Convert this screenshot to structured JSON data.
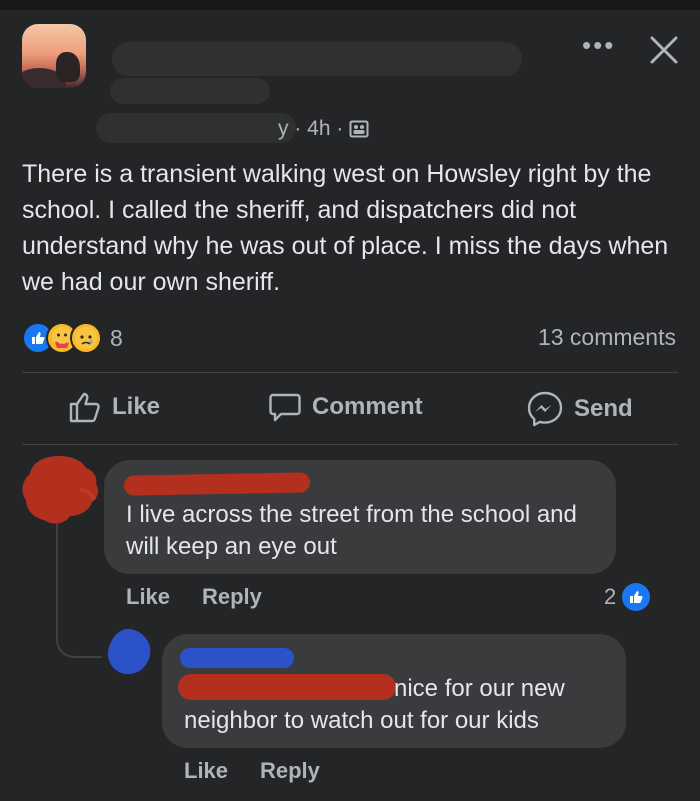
{
  "post": {
    "meta_time": "y · 4h ·",
    "body": "There is a transient walking west on Howsley right by the school.  I called the sheriff, and dispatchers did not understand why he was out of place.  I miss the days when we had our own sheriff.",
    "more_label": "•••",
    "reaction_count": "8",
    "comments_label": "13 comments",
    "reactions": [
      "like-icon",
      "care-icon",
      "sad-icon"
    ]
  },
  "actions": {
    "like": "Like",
    "comment": "Comment",
    "send": "Send"
  },
  "comments": [
    {
      "name_visible": ".",
      "text": "I live across the street from the school and will keep an eye out",
      "like": "Like",
      "reply": "Reply",
      "likes": "2"
    },
    {
      "name_visible": "",
      "text_line1": "nice for our new",
      "text_line2": "neighbor  to watch out for our kids",
      "like": "Like",
      "reply": "Reply"
    }
  ],
  "colors": {
    "background": "#242526",
    "bubble": "#3a3b3c",
    "text": "#e4e6eb",
    "muted": "#b0b3b8",
    "like_blue": "#1877f2"
  }
}
